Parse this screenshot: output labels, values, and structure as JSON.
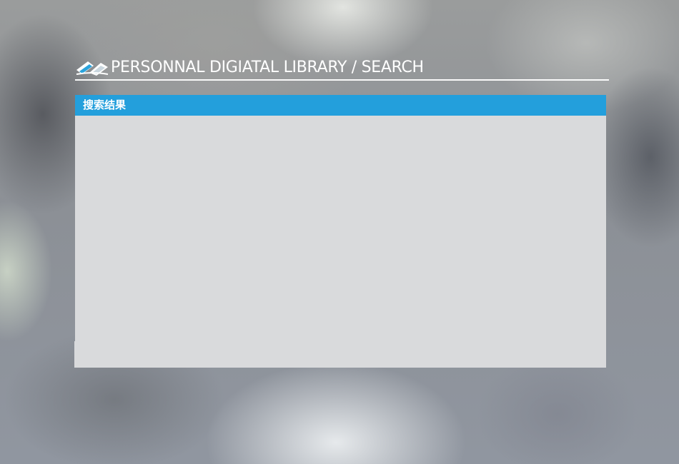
{
  "header": {
    "title": "PERSONNAL DIGIATAL LIBRARY / SEARCH",
    "logo_icon": "open-book-icon"
  },
  "results_panel": {
    "title": "搜索结果",
    "items": []
  },
  "colors": {
    "accent": "#239fdc",
    "panel_bg": "#d9dadc",
    "title_text": "#ffffff"
  }
}
